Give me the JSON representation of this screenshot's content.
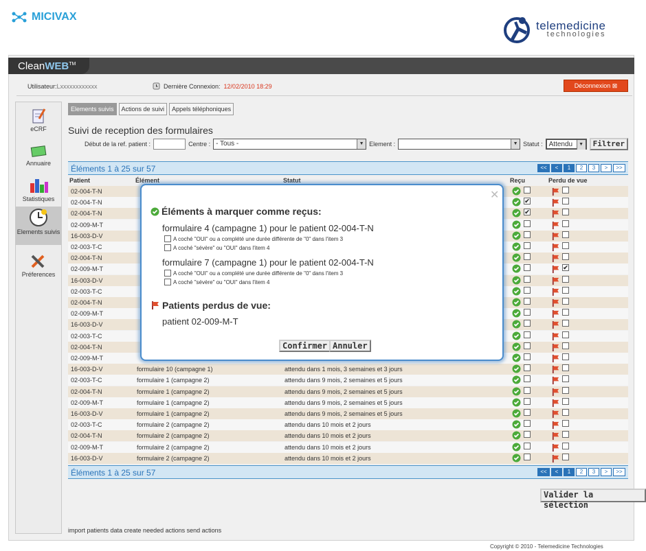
{
  "header": {
    "brand": "MICIVAX",
    "partner_line1": "telemedicine",
    "partner_line2": "technologies",
    "app_name_a": "Clean",
    "app_name_b": "WEB",
    "app_tm": "TM"
  },
  "userbar": {
    "user_label": "Utilisateur:",
    "user_name": "Lxxxxxxxxxxxx",
    "last_conn_label": "Dernière Connexion:",
    "last_conn_date": "12/02/2010 18:29",
    "logout_label": "Déconnexion"
  },
  "sidebar": {
    "items": [
      {
        "label": "eCRF",
        "icon": "ecrf-icon"
      },
      {
        "label": "Annuaire",
        "icon": "directory-icon"
      },
      {
        "label": "Statistiques",
        "icon": "statistics-icon"
      },
      {
        "label": "Elements suivis",
        "icon": "clock-icon"
      },
      {
        "label": "Préferences",
        "icon": "tools-icon"
      }
    ]
  },
  "tabs": [
    "Elements suivis",
    "Actions de suivi",
    "Appels téléphoniques"
  ],
  "page_title": "Suivi de reception des formulaires",
  "filters": {
    "ref_label": "Début de la ref. patient :",
    "ref_value": "",
    "centre_label": "Centre :",
    "centre_value": "- Tous -",
    "element_label": "Element :",
    "element_value": "",
    "status_label": "Statut :",
    "status_value": "Attendu",
    "filter_button": "Filtrer"
  },
  "pagination": {
    "count_text": "Éléments 1 à 25 sur 57",
    "first": "<<",
    "prev": "<",
    "pages": [
      "1",
      "2",
      "3"
    ],
    "next": ">",
    "last": ">>"
  },
  "table": {
    "headers": [
      "Patient",
      "Élément",
      "Statut",
      "Reçu",
      "Perdu de vue"
    ],
    "rows": [
      {
        "patient": "02-004-T-N",
        "element": "",
        "status": "",
        "recu": false,
        "perdu": false
      },
      {
        "patient": "02-004-T-N",
        "element": "",
        "status": "",
        "recu": true,
        "perdu": false
      },
      {
        "patient": "02-004-T-N",
        "element": "",
        "status": "",
        "recu": true,
        "perdu": false
      },
      {
        "patient": "02-009-M-T",
        "element": "",
        "status": "",
        "recu": false,
        "perdu": false
      },
      {
        "patient": "16-003-D-V",
        "element": "",
        "status": "",
        "recu": false,
        "perdu": false
      },
      {
        "patient": "02-003-T-C",
        "element": "",
        "status": "",
        "recu": false,
        "perdu": false
      },
      {
        "patient": "02-004-T-N",
        "element": "",
        "status": "",
        "recu": false,
        "perdu": false
      },
      {
        "patient": "02-009-M-T",
        "element": "",
        "status": "",
        "recu": false,
        "perdu": true
      },
      {
        "patient": "16-003-D-V",
        "element": "",
        "status": "",
        "recu": false,
        "perdu": false
      },
      {
        "patient": "02-003-T-C",
        "element": "",
        "status": "",
        "recu": false,
        "perdu": false
      },
      {
        "patient": "02-004-T-N",
        "element": "",
        "status": "",
        "recu": false,
        "perdu": false
      },
      {
        "patient": "02-009-M-T",
        "element": "",
        "status": "",
        "recu": false,
        "perdu": false
      },
      {
        "patient": "16-003-D-V",
        "element": "",
        "status": "",
        "recu": false,
        "perdu": false
      },
      {
        "patient": "02-003-T-C",
        "element": "",
        "status": "",
        "recu": false,
        "perdu": false
      },
      {
        "patient": "02-004-T-N",
        "element": "",
        "status": "",
        "recu": false,
        "perdu": false
      },
      {
        "patient": "02-009-M-T",
        "element": "",
        "status": "",
        "recu": false,
        "perdu": false
      },
      {
        "patient": "16-003-D-V",
        "element": "formulaire 10 (campagne 1)",
        "status": "attendu dans 1 mois, 3 semaines et 3 jours",
        "recu": false,
        "perdu": false
      },
      {
        "patient": "02-003-T-C",
        "element": "formulaire 1 (campagne 2)",
        "status": "attendu dans 9 mois, 2 semaines et 5 jours",
        "recu": false,
        "perdu": false
      },
      {
        "patient": "02-004-T-N",
        "element": "formulaire 1 (campagne 2)",
        "status": "attendu dans 9 mois, 2 semaines et 5 jours",
        "recu": false,
        "perdu": false
      },
      {
        "patient": "02-009-M-T",
        "element": "formulaire 1 (campagne 2)",
        "status": "attendu dans 9 mois, 2 semaines et 5 jours",
        "recu": false,
        "perdu": false
      },
      {
        "patient": "16-003-D-V",
        "element": "formulaire 1 (campagne 2)",
        "status": "attendu dans 9 mois, 2 semaines et 5 jours",
        "recu": false,
        "perdu": false
      },
      {
        "patient": "02-003-T-C",
        "element": "formulaire 2 (campagne 2)",
        "status": "attendu dans 10 mois et 2 jours",
        "recu": false,
        "perdu": false
      },
      {
        "patient": "02-004-T-N",
        "element": "formulaire 2 (campagne 2)",
        "status": "attendu dans 10 mois et 2 jours",
        "recu": false,
        "perdu": false
      },
      {
        "patient": "02-009-M-T",
        "element": "formulaire 2 (campagne 2)",
        "status": "attendu dans 10 mois et 2 jours",
        "recu": false,
        "perdu": false
      },
      {
        "patient": "16-003-D-V",
        "element": "formulaire 2 (campagne 2)",
        "status": "attendu dans 10 mois et 2 jours",
        "recu": false,
        "perdu": false
      }
    ]
  },
  "validate_button": "Valider la sélection",
  "footer_text": "import patients data create needed actions send actions",
  "copyright": "Copyright © 2010 - Telemedicine Technologies",
  "modal": {
    "close": "✕",
    "received_title": "Éléments à marquer comme reçus:",
    "forms": [
      {
        "title": "formulaire 4 (campagne 1) pour le patient 02-004-T-N",
        "options": [
          "A coché \"OUI\" ou a complété une durée différente de \"0\" dans l'item 3",
          "A coché \"sévère\" ou \"OUI\" dans l'item 4"
        ]
      },
      {
        "title": "formulaire 7 (campagne 1) pour le patient 02-004-T-N",
        "options": [
          "A coché \"OUI\" ou a complété une durée différente de \"0\" dans l'item 3",
          "A coché \"sévère\" ou \"OUI\" dans l'item 4"
        ]
      }
    ],
    "lost_title": "Patients perdus de vue:",
    "lost_patient": "patient 02-009-M-T",
    "confirm": "Confirmer",
    "cancel": "Annuler"
  },
  "colors": {
    "accent": "#2a73b8",
    "danger": "#e2481c",
    "row_even": "#ede4d6"
  }
}
